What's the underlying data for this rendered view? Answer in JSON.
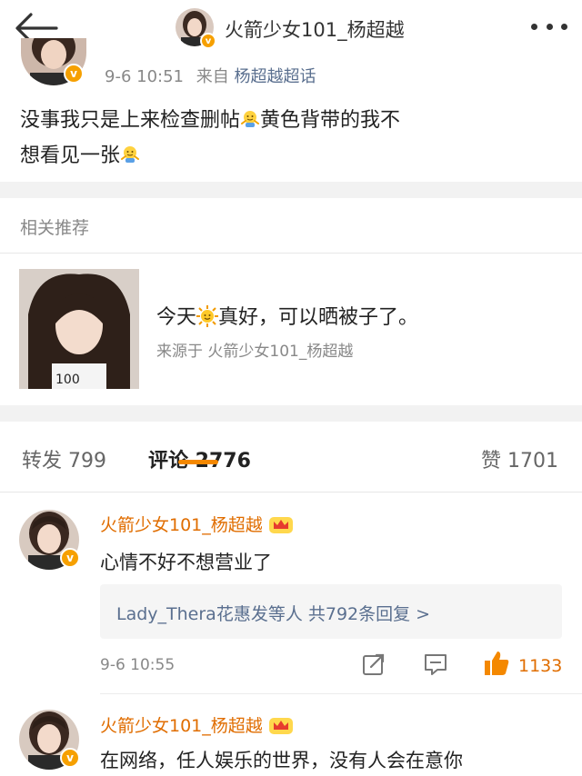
{
  "nav": {
    "title": "火箭少女101_杨超越",
    "back_icon": "back-arrow-icon",
    "more_icon": "more-dots-icon"
  },
  "post": {
    "time": "9-6 10:51",
    "source_prefix": "来自",
    "source": "杨超越超话",
    "text_part1": "没事我只是上来检查删帖",
    "text_part2": "黄色背带的我不",
    "text_part3": "想看见一张",
    "verified_badge": "v"
  },
  "related": {
    "title": "相关推荐",
    "text_part1": "今天",
    "text_part2": "真好，可以晒被子了。",
    "source": "来源于 火箭少女101_杨超越"
  },
  "tabs": {
    "repost": "转发 799",
    "comment": "评论 2776",
    "like": "赞 1701"
  },
  "comments": [
    {
      "name": "火箭少女101_杨超越",
      "text": "心情不好不想营业了",
      "reply_summary": "Lady_Thera花惠发等人 共792条回复 >",
      "time": "9-6 10:55",
      "likes": "1133"
    },
    {
      "name": "火箭少女101_杨超越",
      "text": "在网络，任人娱乐的世界，没有人会在意你"
    }
  ],
  "colors": {
    "accent": "#f48800",
    "name": "#e06d00",
    "link": "#5a6f8f",
    "muted": "#888888"
  }
}
